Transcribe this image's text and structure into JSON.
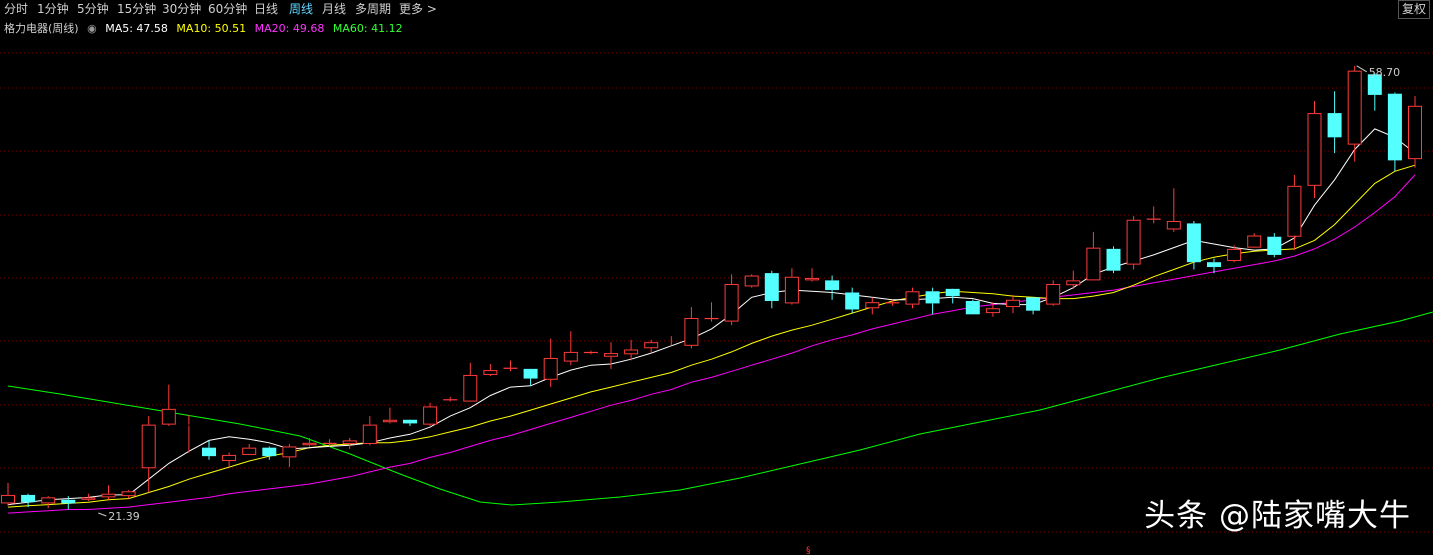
{
  "toolbar": {
    "periods": [
      "分时",
      "1分钟",
      "5分钟",
      "15分钟",
      "30分钟",
      "60分钟",
      "日线",
      "周线",
      "月线",
      "多周期",
      "更多 >"
    ],
    "active_index": 7,
    "adjust_label": "复权"
  },
  "legend": {
    "stock": "格力电器(周线)",
    "ma5": "MA5: 47.58",
    "ma10": "MA10: 50.51",
    "ma20": "MA20: 49.68",
    "ma60": "MA60: 41.12"
  },
  "watermark": "头条 @陆家嘴大牛",
  "colors": {
    "up": "#ff3b3b",
    "down": "#54ffff",
    "ma5": "#ffffff",
    "ma10": "#ffff00",
    "ma20": "#ff00ff",
    "ma60": "#00ff00",
    "grid": "#7a0000"
  },
  "chart_data": {
    "type": "candlestick",
    "ylim": [
      19.5,
      60.5
    ],
    "annotations": {
      "max_label": "58.70",
      "min_label": "21.39"
    },
    "candles": [
      [
        22.6,
        23.3,
        24.3,
        22.4
      ],
      [
        23.3,
        22.7,
        23.4,
        22.3
      ],
      [
        22.6,
        23.1,
        23.2,
        22.2
      ],
      [
        22.9,
        22.6,
        23.2,
        22.1
      ],
      [
        22.9,
        23.1,
        23.4,
        22.8
      ],
      [
        23.1,
        23.4,
        24.1,
        22.9
      ],
      [
        23.2,
        23.6,
        23.7,
        23.0
      ],
      [
        25.5,
        29.1,
        29.8,
        23.5
      ],
      [
        29.1,
        30.4,
        32.4,
        29.0
      ],
      [
        29.1,
        29.1,
        29.9,
        26.8
      ],
      [
        27.2,
        26.5,
        27.8,
        26.2
      ],
      [
        26.1,
        26.6,
        26.8,
        25.6
      ],
      [
        26.6,
        27.2,
        27.5,
        26.7
      ],
      [
        27.2,
        26.5,
        27.3,
        26.2
      ],
      [
        26.4,
        27.3,
        27.5,
        25.6
      ],
      [
        27.4,
        27.6,
        28.0,
        27.3
      ],
      [
        27.5,
        27.6,
        27.9,
        27.3
      ],
      [
        27.5,
        27.8,
        28.0,
        27.1
      ],
      [
        27.5,
        29.1,
        29.8,
        27.4
      ],
      [
        29.3,
        29.5,
        30.5,
        29.2
      ],
      [
        29.5,
        29.2,
        29.4,
        29.0
      ],
      [
        29.1,
        30.6,
        30.9,
        29.0
      ],
      [
        31.1,
        31.2,
        31.4,
        31.0
      ],
      [
        31.0,
        33.2,
        34.2,
        31.0
      ],
      [
        33.2,
        33.6,
        34.1,
        33.1
      ],
      [
        33.7,
        33.8,
        34.4,
        33.5
      ],
      [
        33.7,
        32.9,
        33.4,
        32.3
      ],
      [
        32.8,
        34.6,
        36.2,
        32.2
      ],
      [
        34.3,
        35.1,
        36.8,
        34.0
      ],
      [
        35.0,
        35.1,
        35.2,
        34.9
      ],
      [
        34.7,
        35.0,
        35.9,
        33.7
      ],
      [
        34.9,
        35.3,
        36.1,
        34.4
      ],
      [
        35.4,
        35.9,
        36.1,
        35.0
      ],
      [
        35.7,
        35.7,
        36.4,
        35.7
      ],
      [
        35.6,
        37.9,
        38.8,
        35.4
      ],
      [
        37.8,
        37.9,
        39.2,
        37.6
      ],
      [
        37.6,
        40.7,
        41.5,
        37.3
      ],
      [
        40.5,
        41.4,
        41.5,
        40.4
      ],
      [
        41.6,
        39.3,
        41.8,
        38.7
      ],
      [
        39.1,
        41.3,
        42.0,
        39.0
      ],
      [
        41.0,
        41.2,
        42.0,
        40.9
      ],
      [
        41.0,
        40.2,
        41.4,
        39.4
      ],
      [
        40.0,
        38.6,
        40.4,
        38.3
      ],
      [
        38.7,
        39.2,
        39.6,
        38.2
      ],
      [
        39.1,
        39.2,
        39.4,
        38.9
      ],
      [
        39.0,
        40.1,
        40.4,
        38.7
      ],
      [
        40.1,
        39.1,
        40.4,
        38.2
      ],
      [
        40.3,
        39.7,
        40.2,
        39.1
      ],
      [
        39.3,
        38.2,
        39.4,
        38.2
      ],
      [
        38.3,
        38.7,
        39.2,
        38.0
      ],
      [
        38.8,
        39.4,
        39.8,
        38.3
      ],
      [
        39.6,
        38.5,
        39.6,
        38.2
      ],
      [
        39.0,
        40.7,
        41.0,
        38.9
      ],
      [
        40.6,
        41.0,
        41.8,
        40.3
      ],
      [
        41.0,
        43.7,
        45.0,
        41.0
      ],
      [
        43.6,
        41.8,
        43.8,
        41.6
      ],
      [
        42.3,
        46.0,
        46.3,
        41.9
      ],
      [
        46.0,
        46.1,
        47.1,
        45.7
      ],
      [
        45.2,
        45.9,
        48.6,
        45.0
      ],
      [
        45.7,
        42.5,
        45.9,
        41.9
      ],
      [
        42.5,
        42.1,
        42.8,
        41.6
      ],
      [
        42.6,
        43.6,
        43.9,
        42.5
      ],
      [
        43.7,
        44.7,
        44.9,
        43.8
      ],
      [
        44.6,
        43.1,
        44.9,
        42.9
      ],
      [
        44.6,
        48.8,
        49.7,
        43.5
      ],
      [
        48.8,
        54.8,
        55.8,
        47.8
      ],
      [
        54.8,
        52.8,
        56.6,
        51.5
      ],
      [
        52.2,
        58.3,
        58.7,
        50.8
      ],
      [
        58.0,
        56.3,
        58.1,
        55.0
      ],
      [
        56.4,
        50.9,
        56.5,
        50.0
      ],
      [
        51.0,
        55.4,
        56.2,
        50.3
      ]
    ],
    "ma5": [
      22.5,
      22.7,
      22.9,
      23.0,
      23.1,
      23.3,
      23.3,
      24.6,
      25.9,
      26.9,
      27.8,
      28.1,
      27.9,
      27.6,
      27.1,
      27.2,
      27.3,
      27.4,
      27.6,
      28.0,
      28.3,
      28.9,
      29.8,
      30.5,
      31.5,
      32.2,
      32.3,
      33.0,
      33.6,
      34.0,
      34.1,
      34.5,
      35.0,
      35.6,
      36.2,
      37.0,
      38.2,
      39.6,
      40.0,
      40.2,
      40.1,
      40.0,
      39.8,
      39.6,
      39.4,
      39.4,
      39.5,
      39.6,
      39.5,
      39.1,
      39.0,
      39.0,
      39.6,
      40.4,
      41.5,
      42.1,
      42.6,
      43.1,
      43.7,
      44.3,
      44.0,
      43.7,
      43.5,
      43.6,
      44.5,
      47.2,
      49.3,
      51.8,
      53.5,
      52.8,
      51.5
    ],
    "ma10": [
      22.3,
      22.4,
      22.5,
      22.6,
      22.7,
      22.9,
      23.0,
      23.5,
      24.0,
      24.6,
      25.1,
      25.6,
      26.1,
      26.5,
      26.8,
      27.2,
      27.4,
      27.5,
      27.6,
      27.6,
      27.8,
      28.1,
      28.5,
      28.9,
      29.4,
      29.8,
      30.3,
      30.8,
      31.3,
      31.8,
      32.2,
      32.6,
      33.0,
      33.4,
      34.0,
      34.5,
      35.1,
      35.8,
      36.4,
      36.9,
      37.3,
      37.8,
      38.3,
      38.8,
      39.3,
      39.6,
      39.9,
      40.1,
      40.0,
      39.9,
      39.7,
      39.6,
      39.5,
      39.5,
      39.7,
      40.0,
      40.6,
      41.3,
      41.9,
      42.5,
      42.9,
      43.2,
      43.4,
      43.5,
      43.6,
      44.3,
      45.6,
      47.3,
      49.0,
      50.0,
      50.5
    ],
    "ma20": [
      21.8,
      21.9,
      22.0,
      22.1,
      22.1,
      22.2,
      22.3,
      22.5,
      22.7,
      22.9,
      23.1,
      23.4,
      23.6,
      23.8,
      24.0,
      24.2,
      24.5,
      24.8,
      25.2,
      25.6,
      25.9,
      26.4,
      26.8,
      27.3,
      27.8,
      28.2,
      28.7,
      29.2,
      29.7,
      30.2,
      30.7,
      31.1,
      31.6,
      32.0,
      32.6,
      33.0,
      33.5,
      34.0,
      34.5,
      35.0,
      35.6,
      36.1,
      36.5,
      37.0,
      37.4,
      37.8,
      38.2,
      38.5,
      38.8,
      39.0,
      39.2,
      39.4,
      39.6,
      39.8,
      40.0,
      40.2,
      40.5,
      40.8,
      41.1,
      41.4,
      41.7,
      42.0,
      42.3,
      42.6,
      43.0,
      43.6,
      44.4,
      45.4,
      46.6,
      47.9,
      49.7
    ]
  }
}
